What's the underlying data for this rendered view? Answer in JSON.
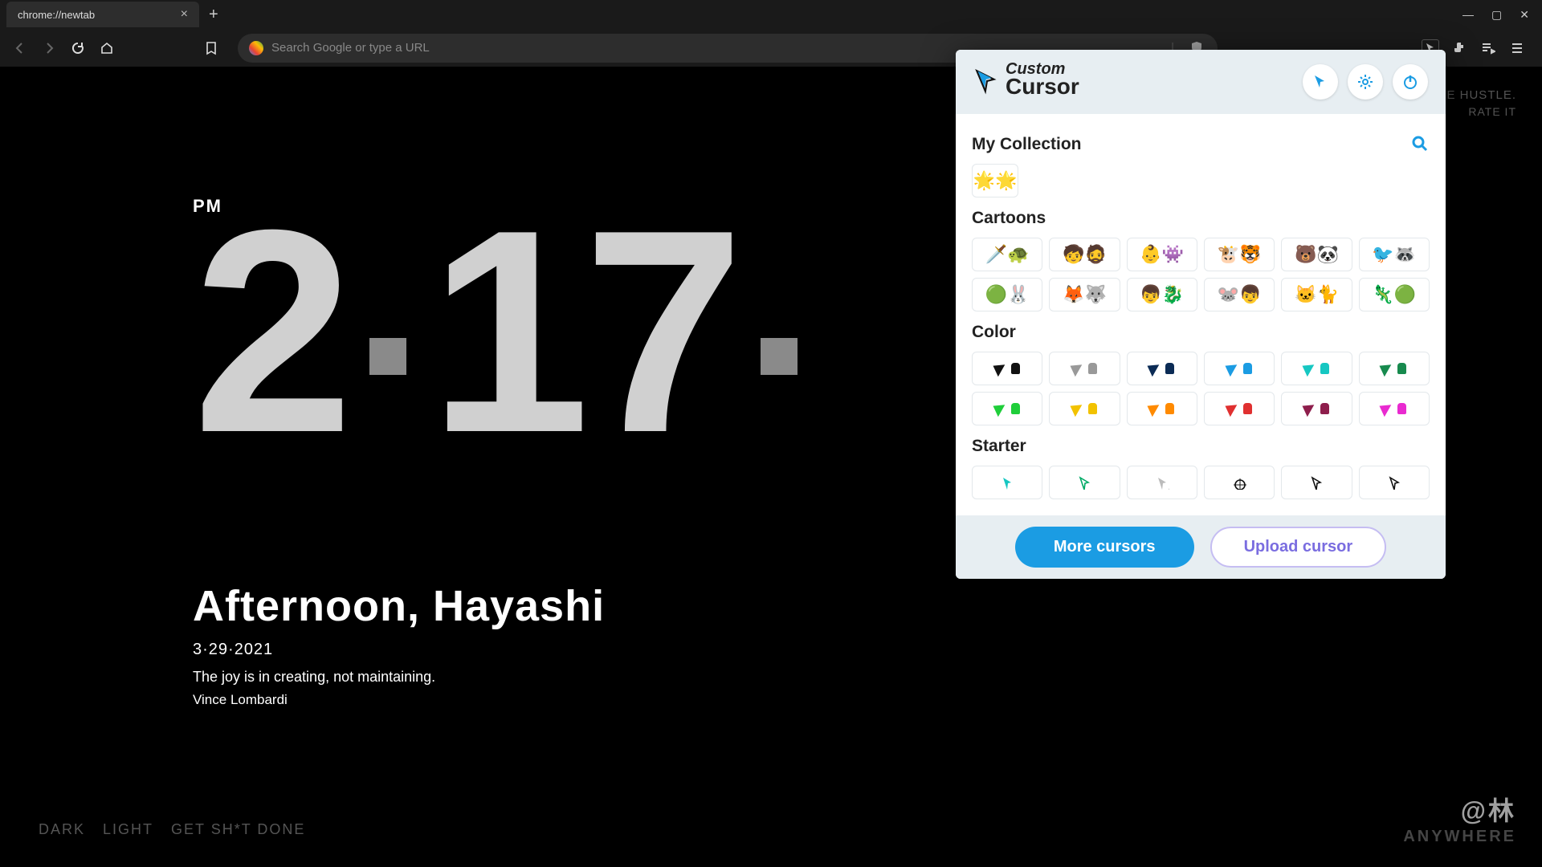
{
  "browser": {
    "tab_title": "chrome://newtab",
    "url_placeholder": "Search Google or type a URL"
  },
  "newtab": {
    "meridiem": "PM",
    "hour": "2",
    "minute": "17",
    "greeting": "Afternoon, Hayashi",
    "date": "3·29·2021",
    "quote": "The joy is in creating, not maintaining.",
    "author": "Vince Lombardi",
    "themes": [
      "DARK",
      "LIGHT",
      "GET SH*T DONE"
    ],
    "tagline_top": "SAME HUSTLE.",
    "tagline_rate": "RATE IT",
    "watermark_jp": "@林",
    "watermark_en": "ANYWHERE"
  },
  "popup": {
    "brand": "Custom Cursor",
    "sections": {
      "my_collection": {
        "title": "My Collection",
        "items": [
          "🌟🌟"
        ]
      },
      "cartoons": {
        "title": "Cartoons",
        "items": [
          "🗡️🐢",
          "🧒🧔",
          "👶👾",
          "🐮🐯",
          "🐻🐼",
          "🐦🦝",
          "🟢🐰",
          "🦊🐺",
          "👦🐉",
          "🐭👦",
          "🐱🐈",
          "🦎🟢"
        ]
      },
      "color": {
        "title": "Color",
        "colors": [
          "#111",
          "#999",
          "#0b2b55",
          "#1b9ce3",
          "#16c7c2",
          "#178a4e",
          "#1fce3a",
          "#f2c200",
          "#ff8a00",
          "#e03030",
          "#8e1e4c",
          "#e92ad0"
        ]
      },
      "starter": {
        "title": "Starter",
        "items": [
          "ptr-teal",
          "ptr-hand",
          "ptr-grey",
          "crosshair",
          "ptr-outline",
          "ptr-rock"
        ]
      }
    },
    "more_btn": "More cursors",
    "upload_btn": "Upload cursor"
  }
}
